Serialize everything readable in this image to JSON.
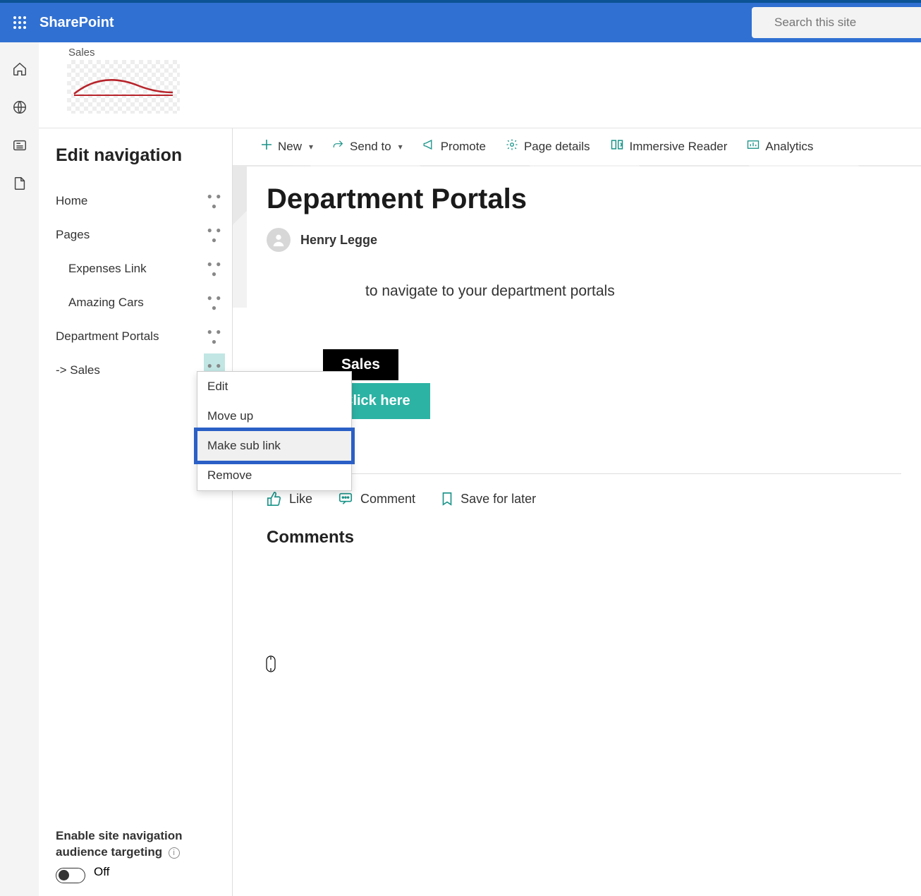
{
  "brand": "SharePoint",
  "search": {
    "placeholder": "Search this site"
  },
  "site": {
    "name": "Sales"
  },
  "navPanel": {
    "title": "Edit navigation",
    "items": [
      {
        "label": "Home",
        "sub": false
      },
      {
        "label": "Pages",
        "sub": false
      },
      {
        "label": "Expenses Link",
        "sub": true
      },
      {
        "label": "Amazing Cars",
        "sub": true
      },
      {
        "label": "Department Portals",
        "sub": false
      },
      {
        "label": "-> Sales",
        "sub": false
      }
    ],
    "footer": {
      "label": "Enable site navigation audience targeting",
      "toggleState": "Off"
    }
  },
  "contextMenu": {
    "items": [
      "Edit",
      "Move up",
      "Make sub link",
      "Remove"
    ],
    "highlighted": 2
  },
  "commandBar": {
    "new": "New",
    "sendTo": "Send to",
    "promote": "Promote",
    "pageDetails": "Page details",
    "immersive": "Immersive Reader",
    "analytics": "Analytics"
  },
  "page": {
    "title": "Department Portals",
    "author": "Henry Legge",
    "subtitle": "to navigate to your department portals",
    "tile": {
      "name": "Sales",
      "button": "Click here"
    }
  },
  "actions": {
    "like": "Like",
    "comment": "Comment",
    "save": "Save for later"
  },
  "commentsHeading": "Comments"
}
